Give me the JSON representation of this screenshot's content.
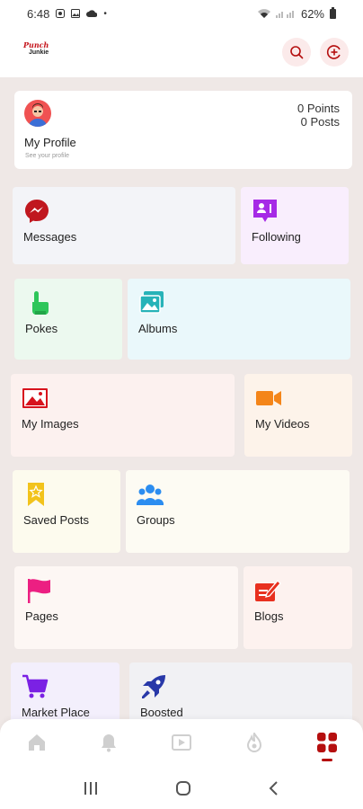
{
  "status_bar": {
    "time": "6:48",
    "battery": "62%"
  },
  "header": {
    "logo_top": "Punch",
    "logo_bottom": "Junkie",
    "logo_icon": "app-logo"
  },
  "profile": {
    "name": "My Profile",
    "subtitle": "See your profile",
    "points": "0 Points",
    "posts": "0 Posts"
  },
  "tiles": [
    {
      "label": "Messages",
      "icon": "messenger-icon",
      "bg": "#f3f4f8",
      "accent": "#c0171f"
    },
    {
      "label": "Following",
      "icon": "following-icon",
      "bg": "#f9eefd",
      "accent": "#a62ae6"
    },
    {
      "label": "Pokes",
      "icon": "poke-hand-icon",
      "bg": "#ecf9ef",
      "accent": "#2ec65a"
    },
    {
      "label": "Albums",
      "icon": "albums-icon",
      "bg": "#eaf8fb",
      "accent": "#27b3b8"
    },
    {
      "label": "My Images",
      "icon": "images-icon",
      "bg": "#fcf1ef",
      "accent": "#d7131d"
    },
    {
      "label": "My Videos",
      "icon": "video-camera-icon",
      "bg": "#fdf3ea",
      "accent": "#f48519"
    },
    {
      "label": "Saved Posts",
      "icon": "bookmark-star-icon",
      "bg": "#fdfbee",
      "accent": "#f2c31b"
    },
    {
      "label": "Groups",
      "icon": "groups-icon",
      "bg": "#fdfbf3",
      "accent": "#2c8df0"
    },
    {
      "label": "Pages",
      "icon": "flag-icon",
      "bg": "#fdf7f4",
      "accent": "#ec1f82"
    },
    {
      "label": "Blogs",
      "icon": "blog-pen-icon",
      "bg": "#fdf2ef",
      "accent": "#e8301f"
    },
    {
      "label": "Market Place",
      "icon": "cart-icon",
      "bg": "#f3effc",
      "accent": "#7b21e4"
    },
    {
      "label": "Boosted",
      "icon": "rocket-icon",
      "bg": "#f1f1f4",
      "accent": "#2838a8"
    }
  ],
  "bottom_nav": [
    {
      "icon": "home-icon"
    },
    {
      "icon": "bell-icon"
    },
    {
      "icon": "video-play-icon"
    },
    {
      "icon": "fire-icon"
    },
    {
      "icon": "grid-menu-icon",
      "active": true
    }
  ],
  "colors": {
    "brand": "#b50f0f",
    "background": "#efe8e6"
  }
}
